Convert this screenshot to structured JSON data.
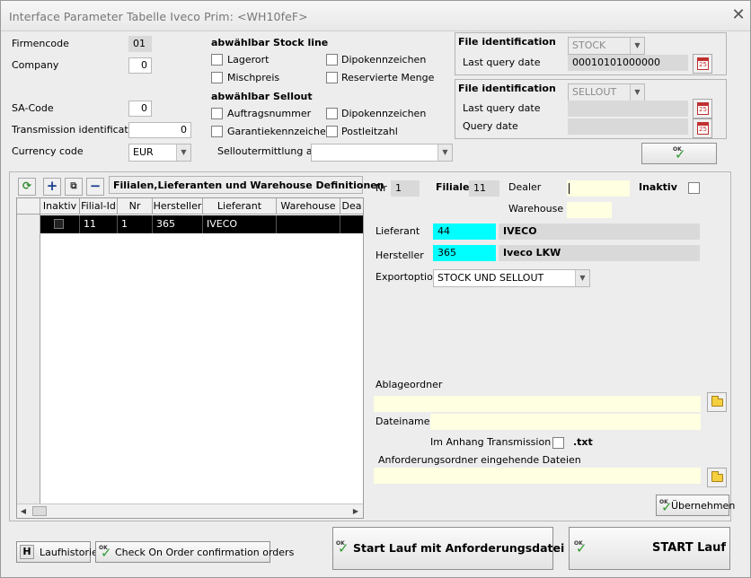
{
  "window": {
    "title": "Interface Parameter Tabelle Iveco Prim: <WH10feF>"
  },
  "left": {
    "firmencode_label": "Firmencode",
    "firmencode_value": "01",
    "company_label": "Company",
    "company_value": "0",
    "sa_code_label": "SA-Code",
    "sa_code_value": "0",
    "transmission_label": "Transmission identification",
    "transmission_value": "0",
    "currency_label": "Currency code",
    "currency_value": "EUR"
  },
  "stockline": {
    "heading": "abwählbar Stock line",
    "items": [
      "Lagerort",
      "Dipokennzeichen",
      "Mischpreis",
      "Reservierte Menge"
    ]
  },
  "sellout": {
    "heading": "abwählbar Sellout",
    "items": [
      "Auftragsnummer",
      "Dipokennzeichen",
      "Garantiekennzeichen",
      "Postleitzahl"
    ],
    "ermittlung_label": "Selloutermittlung aus",
    "ermittlung_value": ""
  },
  "fileid1": {
    "label": "File identification",
    "combo": "STOCK",
    "last_query_label": "Last query date",
    "last_query_value": "00010101000000"
  },
  "fileid2": {
    "label": "File identification",
    "combo": "SELLOUT",
    "last_query_label": "Last query date",
    "query_label": "Query date",
    "last_query_value": "",
    "query_value": ""
  },
  "toolbar": {
    "section_title": "Filialen,Lieferanten und Warehouse Definitionen"
  },
  "grid": {
    "columns": [
      "Inaktiv",
      "Filial-Id",
      "Nr",
      "Hersteller",
      "Lieferant",
      "Warehouse",
      "Dea"
    ],
    "rows": [
      {
        "inaktiv": "",
        "filial_id": "11",
        "nr": "1",
        "hersteller": "365",
        "lieferant": "IVECO",
        "warehouse": "",
        "dealer": ""
      }
    ]
  },
  "detail": {
    "nr_label": "Nr",
    "nr_value": "1",
    "filiale_label": "Filiale",
    "filiale_value": "11",
    "dealer_label": "Dealer",
    "dealer_value": "",
    "inaktiv_label": "Inaktiv",
    "warehouse_label": "Warehouse",
    "warehouse_value": "",
    "lieferant_label": "Lieferant",
    "lieferant_code": "44",
    "lieferant_name": "IVECO",
    "hersteller_label": "Hersteller",
    "hersteller_code": "365",
    "hersteller_name": "Iveco LKW",
    "exportoption_label": "Exportoption",
    "exportoption_value": "STOCK UND SELLOUT",
    "ablage_label": "Ablageordner",
    "ablage_value": "",
    "dateiname_label": "Dateiname",
    "dateiname_value": "",
    "anhang_label": "Im Anhang Transmission ID",
    "txt_label": ".txt",
    "anforderung_label": "Anforderungsordner eingehende Dateien",
    "anforderung_value": "",
    "uebernehmen_label": "Übernehmen"
  },
  "bottom": {
    "laufhistorie": "Laufhistorie",
    "laufhistorie_key": "H",
    "check_on_order": "Check On Order confirmation orders",
    "start_anforderung": "Start Lauf mit Anforderungsdatei",
    "start_lauf": "START Lauf"
  },
  "icons": {
    "ok_text": "OK",
    "cal_text": "25",
    "close": "✕"
  }
}
